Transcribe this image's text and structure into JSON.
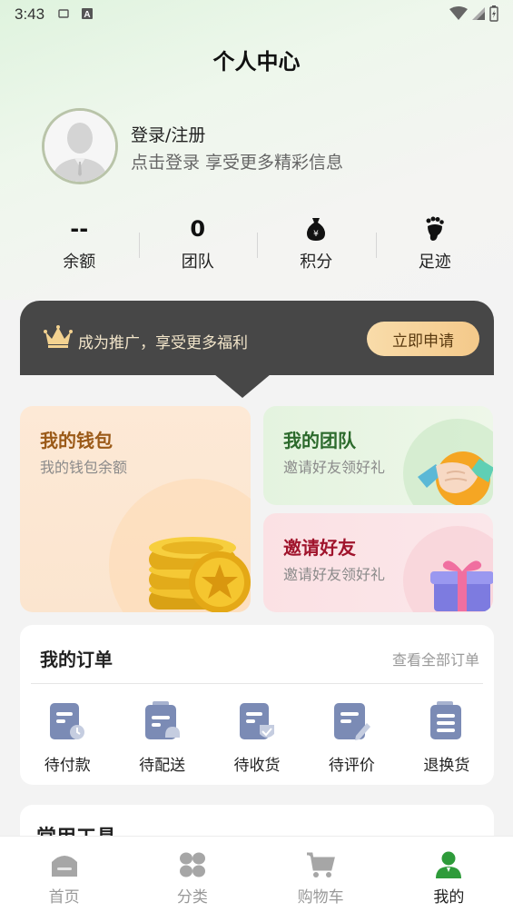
{
  "status_bar": {
    "time": "3:43"
  },
  "header": {
    "title": "个人中心"
  },
  "profile": {
    "login_label": "登录/注册",
    "subtitle": "点击登录 享受更多精彩信息"
  },
  "stats": [
    {
      "value": "--",
      "label": "余额"
    },
    {
      "value": "0",
      "label": "团队"
    },
    {
      "icon": "money-bag-icon",
      "label": "积分"
    },
    {
      "icon": "footprint-icon",
      "label": "足迹"
    }
  ],
  "promo": {
    "text": "成为推广，享受更多福利",
    "button": "立即申请"
  },
  "cards": {
    "wallet": {
      "title": "我的钱包",
      "subtitle": "我的钱包余额"
    },
    "team": {
      "title": "我的团队",
      "subtitle": "邀请好友领好礼"
    },
    "invite": {
      "title": "邀请好友",
      "subtitle": "邀请好友领好礼"
    }
  },
  "orders": {
    "title": "我的订单",
    "view_all": "查看全部订单",
    "items": [
      {
        "label": "待付款",
        "icon": "pending-payment-icon"
      },
      {
        "label": "待配送",
        "icon": "pending-delivery-icon"
      },
      {
        "label": "待收货",
        "icon": "pending-receipt-icon"
      },
      {
        "label": "待评价",
        "icon": "pending-review-icon"
      },
      {
        "label": "退换货",
        "icon": "return-exchange-icon"
      }
    ]
  },
  "tools": {
    "title": "常用工具"
  },
  "tabbar": [
    {
      "label": "首页",
      "icon": "home-icon"
    },
    {
      "label": "分类",
      "icon": "category-icon"
    },
    {
      "label": "购物车",
      "icon": "cart-icon"
    },
    {
      "label": "我的",
      "icon": "user-icon",
      "active": true
    }
  ],
  "colors": {
    "accent_green": "#2e9b3a",
    "promo_bg": "#474747",
    "apply_button": "#f6d29a"
  }
}
